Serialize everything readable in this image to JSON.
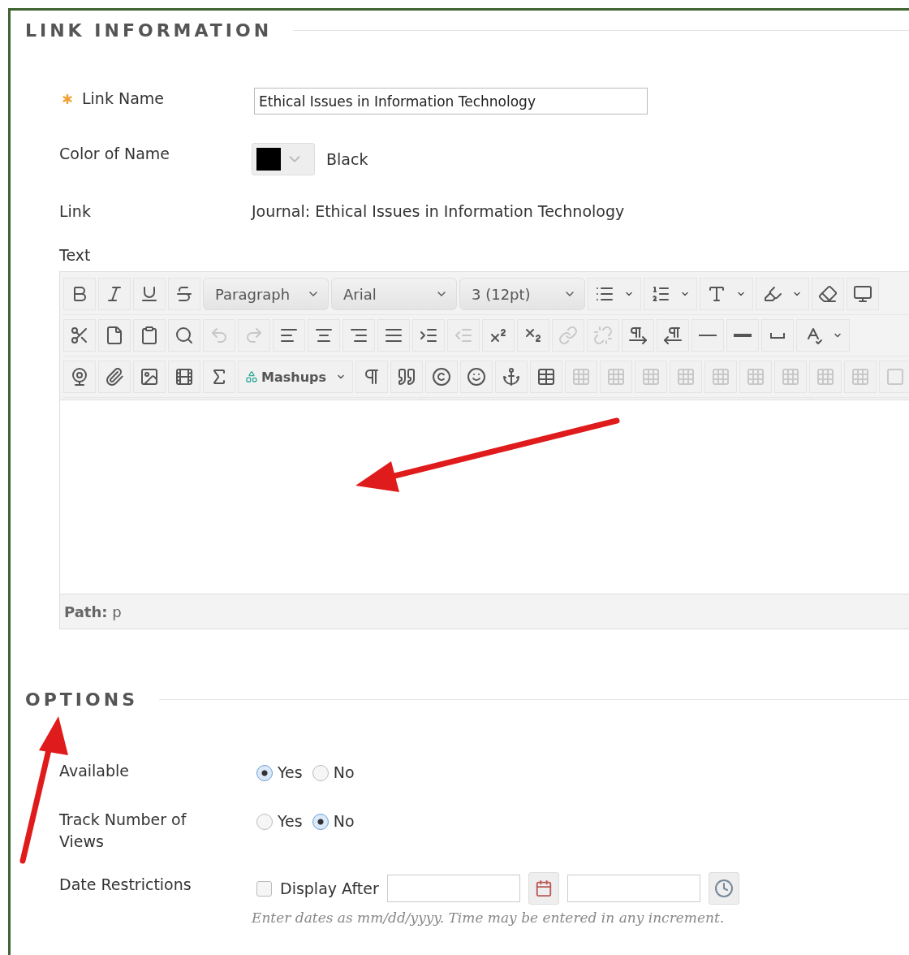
{
  "link_information": {
    "title": "LINK INFORMATION",
    "link_name": {
      "label": "Link Name",
      "required": true,
      "value": "Ethical Issues in Information Technology"
    },
    "color_of_name": {
      "label": "Color of Name",
      "value": "Black"
    },
    "link": {
      "label": "Link",
      "value": "Journal: Ethical Issues in Information Technology"
    },
    "text": {
      "label": "Text",
      "toolbar_rows": [
        [
          {
            "kind": "button",
            "disabled": false
          },
          {
            "kind": "button",
            "disabled": false
          },
          {
            "kind": "button",
            "disabled": false
          },
          {
            "kind": "button",
            "disabled": false
          },
          {
            "kind": "select",
            "value": "Paragraph"
          },
          {
            "kind": "select",
            "value": "Arial"
          },
          {
            "kind": "select",
            "value": "3 (12pt)"
          },
          {
            "kind": "menu",
            "disabled": false
          },
          {
            "kind": "menu",
            "disabled": false
          },
          {
            "kind": "menu",
            "disabled": false
          },
          {
            "kind": "menu",
            "disabled": false
          },
          {
            "kind": "button",
            "disabled": false
          },
          {
            "kind": "button",
            "disabled": false
          }
        ],
        [
          {
            "kind": "button",
            "disabled": false
          },
          {
            "kind": "button",
            "disabled": false
          },
          {
            "kind": "button",
            "disabled": false
          },
          {
            "kind": "button",
            "disabled": false
          },
          {
            "kind": "button",
            "disabled": true
          },
          {
            "kind": "button",
            "disabled": true
          },
          {
            "kind": "button",
            "disabled": false
          },
          {
            "kind": "button",
            "disabled": false
          },
          {
            "kind": "button",
            "disabled": false
          },
          {
            "kind": "button",
            "disabled": false
          },
          {
            "kind": "button",
            "disabled": false
          },
          {
            "kind": "button",
            "disabled": true
          },
          {
            "kind": "button",
            "disabled": false
          },
          {
            "kind": "button",
            "disabled": false
          },
          {
            "kind": "button",
            "disabled": true
          },
          {
            "kind": "button",
            "disabled": true
          },
          {
            "kind": "button",
            "disabled": false
          },
          {
            "kind": "button",
            "disabled": false
          },
          {
            "kind": "button",
            "disabled": false
          },
          {
            "kind": "button",
            "disabled": false
          },
          {
            "kind": "button",
            "disabled": false
          },
          {
            "kind": "menu",
            "disabled": false
          }
        ],
        [
          {
            "kind": "button",
            "disabled": false
          },
          {
            "kind": "button",
            "disabled": false
          },
          {
            "kind": "button",
            "disabled": false
          },
          {
            "kind": "button",
            "disabled": false
          },
          {
            "kind": "button",
            "disabled": false
          },
          {
            "kind": "menu",
            "label": "Mashups",
            "disabled": false
          },
          {
            "kind": "button",
            "disabled": false
          },
          {
            "kind": "button",
            "disabled": false
          },
          {
            "kind": "button",
            "disabled": false
          },
          {
            "kind": "button",
            "disabled": false
          },
          {
            "kind": "button",
            "disabled": false
          },
          {
            "kind": "button",
            "disabled": false
          },
          {
            "kind": "button",
            "disabled": true
          },
          {
            "kind": "button",
            "disabled": true
          },
          {
            "kind": "button",
            "disabled": true
          },
          {
            "kind": "button",
            "disabled": true
          },
          {
            "kind": "button",
            "disabled": true
          },
          {
            "kind": "button",
            "disabled": true
          },
          {
            "kind": "button",
            "disabled": true
          },
          {
            "kind": "button",
            "disabled": true
          },
          {
            "kind": "button",
            "disabled": true
          },
          {
            "kind": "button",
            "disabled": true
          }
        ]
      ],
      "path": "**Path:** p"
    }
  },
  "options": {
    "title": "OPTIONS",
    "available": {
      "label": "Available",
      "choices": [
        {
          "label": "Yes",
          "selected": true
        },
        {
          "label": "No",
          "selected": false
        }
      ]
    },
    "track_views": {
      "label": "Track Number of Views",
      "choices": [
        {
          "label": "Yes",
          "selected": false
        },
        {
          "label": "No",
          "selected": true
        }
      ]
    },
    "date_restrictions": {
      "label": "Date Restrictions",
      "display_after": {
        "label": "Display After",
        "checked": false
      },
      "hint": "Enter dates as mm/dd/yyyy. Time may be entered in any increment."
    }
  }
}
